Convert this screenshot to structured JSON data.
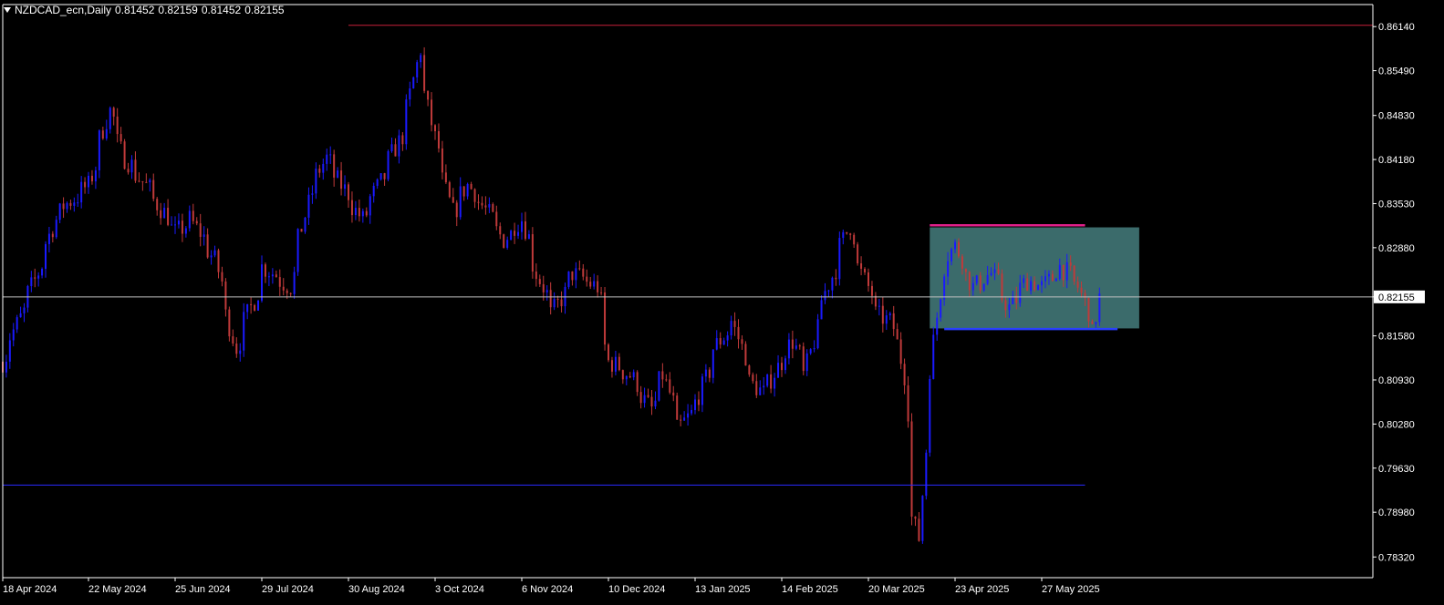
{
  "header": {
    "symbol": "NZDCAD_ecn,Daily",
    "open": "0.81452",
    "high": "0.82159",
    "low": "0.81452",
    "close": "0.82155"
  },
  "price_label": "0.82155",
  "colors": {
    "background": "#000000",
    "axis": "#ffffff",
    "bull": "#1a1aff",
    "bear": "#c03a3a",
    "resistance_line": "#c8203a",
    "support_line": "#2a2aff",
    "zone_fill": "#3b6b6b",
    "zone_top": "#e0208a",
    "zone_bottom": "#2a40ff",
    "price_line": "#c0c0c0"
  },
  "chart_data": {
    "type": "candlestick",
    "timeframe": "Daily",
    "ylim": [
      0.78015,
      0.86465
    ],
    "y_ticks": [
      "0.86140",
      "0.85490",
      "0.84830",
      "0.84180",
      "0.83530",
      "0.82880",
      "0.82155",
      "0.81580",
      "0.80930",
      "0.80280",
      "0.79630",
      "0.78980",
      "0.78320"
    ],
    "x_ticks": [
      {
        "label": "18 Apr 2024",
        "date": "2024-04-18"
      },
      {
        "label": "22 May 2024",
        "date": "2024-05-22"
      },
      {
        "label": "25 Jun 2024",
        "date": "2024-06-25"
      },
      {
        "label": "29 Jul 2024",
        "date": "2024-07-29"
      },
      {
        "label": "30 Aug 2024",
        "date": "2024-08-30"
      },
      {
        "label": "3 Oct 2024",
        "date": "2024-10-03"
      },
      {
        "label": "6 Nov 2024",
        "date": "2024-11-06"
      },
      {
        "label": "10 Dec 2024",
        "date": "2024-12-10"
      },
      {
        "label": "13 Jan 2025",
        "date": "2025-01-13"
      },
      {
        "label": "14 Feb 2025",
        "date": "2025-02-14"
      },
      {
        "label": "20 Mar 2025",
        "date": "2025-03-20"
      },
      {
        "label": "23 Apr 2025",
        "date": "2025-04-23"
      },
      {
        "label": "27 May 2025",
        "date": "2025-05-27"
      }
    ],
    "path_anchors": [
      {
        "date": "2024-04-18",
        "close": 0.812
      },
      {
        "date": "2024-05-01",
        "close": 0.824
      },
      {
        "date": "2024-05-10",
        "close": 0.834
      },
      {
        "date": "2024-05-22",
        "close": 0.838
      },
      {
        "date": "2024-05-30",
        "close": 0.849
      },
      {
        "date": "2024-06-05",
        "close": 0.842
      },
      {
        "date": "2024-06-15",
        "close": 0.837
      },
      {
        "date": "2024-06-25",
        "close": 0.831
      },
      {
        "date": "2024-07-01",
        "close": 0.833
      },
      {
        "date": "2024-07-10",
        "close": 0.827
      },
      {
        "date": "2024-07-18",
        "close": 0.814
      },
      {
        "date": "2024-07-25",
        "close": 0.821
      },
      {
        "date": "2024-07-29",
        "close": 0.826
      },
      {
        "date": "2024-08-08",
        "close": 0.823
      },
      {
        "date": "2024-08-16",
        "close": 0.837
      },
      {
        "date": "2024-08-22",
        "close": 0.842
      },
      {
        "date": "2024-08-28",
        "close": 0.838
      },
      {
        "date": "2024-09-05",
        "close": 0.833
      },
      {
        "date": "2024-09-14",
        "close": 0.84
      },
      {
        "date": "2024-09-22",
        "close": 0.847
      },
      {
        "date": "2024-09-27",
        "close": 0.858
      },
      {
        "date": "2024-10-03",
        "close": 0.845
      },
      {
        "date": "2024-10-10",
        "close": 0.834
      },
      {
        "date": "2024-10-16",
        "close": 0.838
      },
      {
        "date": "2024-10-22",
        "close": 0.835
      },
      {
        "date": "2024-10-30",
        "close": 0.83
      },
      {
        "date": "2024-11-06",
        "close": 0.833
      },
      {
        "date": "2024-11-12",
        "close": 0.825
      },
      {
        "date": "2024-11-18",
        "close": 0.819
      },
      {
        "date": "2024-11-26",
        "close": 0.825
      },
      {
        "date": "2024-12-05",
        "close": 0.823
      },
      {
        "date": "2024-12-10",
        "close": 0.812
      },
      {
        "date": "2024-12-18",
        "close": 0.81
      },
      {
        "date": "2024-12-26",
        "close": 0.805
      },
      {
        "date": "2024-12-31",
        "close": 0.81
      },
      {
        "date": "2025-01-06",
        "close": 0.802
      },
      {
        "date": "2025-01-13",
        "close": 0.806
      },
      {
        "date": "2025-01-20",
        "close": 0.814
      },
      {
        "date": "2025-01-27",
        "close": 0.818
      },
      {
        "date": "2025-02-03",
        "close": 0.809
      },
      {
        "date": "2025-02-08",
        "close": 0.807
      },
      {
        "date": "2025-02-14",
        "close": 0.812
      },
      {
        "date": "2025-02-19",
        "close": 0.815
      },
      {
        "date": "2025-02-24",
        "close": 0.81
      },
      {
        "date": "2025-03-02",
        "close": 0.82
      },
      {
        "date": "2025-03-09",
        "close": 0.828
      },
      {
        "date": "2025-03-13",
        "close": 0.832
      },
      {
        "date": "2025-03-17",
        "close": 0.826
      },
      {
        "date": "2025-03-24",
        "close": 0.819
      },
      {
        "date": "2025-03-31",
        "close": 0.817
      },
      {
        "date": "2025-04-03",
        "close": 0.81
      },
      {
        "date": "2025-04-07",
        "close": 0.789
      },
      {
        "date": "2025-04-09",
        "close": 0.786
      },
      {
        "date": "2025-04-11",
        "close": 0.799
      },
      {
        "date": "2025-04-15",
        "close": 0.815
      },
      {
        "date": "2025-04-18",
        "close": 0.826
      },
      {
        "date": "2025-04-23",
        "close": 0.829
      },
      {
        "date": "2025-04-30",
        "close": 0.823
      },
      {
        "date": "2025-05-07",
        "close": 0.825
      },
      {
        "date": "2025-05-14",
        "close": 0.82
      },
      {
        "date": "2025-05-21",
        "close": 0.824
      },
      {
        "date": "2025-05-27",
        "close": 0.823
      },
      {
        "date": "2025-06-03",
        "close": 0.826
      },
      {
        "date": "2025-06-10",
        "close": 0.823
      },
      {
        "date": "2025-06-16",
        "close": 0.816
      },
      {
        "date": "2025-06-18",
        "close": 0.8215
      }
    ],
    "annotations": {
      "resistance_line": {
        "price": 0.8616,
        "from": "2024-08-30",
        "to": "end"
      },
      "support_line": {
        "price": 0.7938,
        "from": "start",
        "to": "2025-06-12"
      },
      "range_zone": {
        "top": 0.8318,
        "bottom": 0.8169,
        "from": "2025-04-14",
        "to": "2025-07-03"
      },
      "zone_top_line": {
        "price": 0.8321,
        "from": "2025-04-14",
        "to": "2025-06-12"
      },
      "zone_bottom_line": {
        "price": 0.8168,
        "from": "2025-04-18",
        "to": "2025-06-25"
      },
      "current_price_line": {
        "price": 0.82155
      }
    }
  }
}
